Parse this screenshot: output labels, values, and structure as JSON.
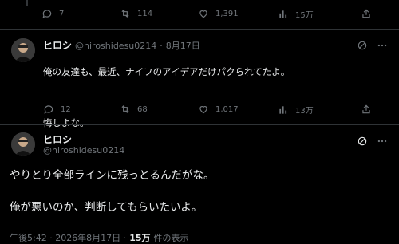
{
  "top_actions": {
    "replies": "7",
    "retweets": "114",
    "likes": "1,391",
    "views": "15万"
  },
  "reply_tweet": {
    "display_name": "ヒロシ",
    "handle": "@hiroshidesu0214",
    "separator": "·",
    "date": "8月17日",
    "text_line1": "俺の友達も、最近、ナイフのアイデアだけパクられてたよ。",
    "text_line2": "悔しよな。",
    "replies": "12",
    "retweets": "68",
    "likes": "1,017",
    "views": "13万"
  },
  "main_tweet": {
    "display_name": "ヒロシ",
    "handle": "@hiroshidesu0214",
    "text_line1": "やりとり全部ラインに残っとるんだがな。",
    "text_line2": "俺が悪いのか、判断してもらいたいよ。",
    "timestamp": "午後5:42 · 2026年8月17日 ·",
    "views_count": "15万",
    "views_label": "件の表示"
  },
  "icons": [
    "reply-icon",
    "retweet-icon",
    "like-icon",
    "views-icon",
    "share-icon",
    "grok-icon",
    "more-icon"
  ]
}
